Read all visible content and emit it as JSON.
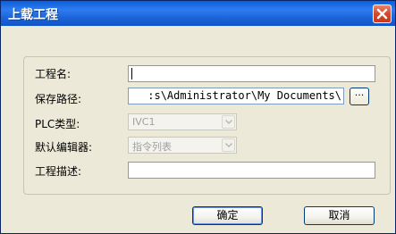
{
  "window": {
    "title": "上载工程"
  },
  "form": {
    "project_name": {
      "label": "工程名:",
      "value": ""
    },
    "save_path": {
      "label": "保存路径:",
      "value": ":s\\Administrator\\My Documents\\",
      "browse_label": "···"
    },
    "plc_type": {
      "label": "PLC类型:",
      "value": "IVC1"
    },
    "default_editor": {
      "label": "默认编辑器:",
      "value": "指令列表"
    },
    "description": {
      "label": "工程描述:",
      "value": ""
    }
  },
  "buttons": {
    "ok": "确定",
    "cancel": "取消"
  },
  "icons": {
    "close": "close-icon",
    "dropdown": "chevron-down-icon"
  },
  "colors": {
    "titlebar": "#0a5ed7",
    "close_button": "#d5482a",
    "dialog_bg": "#ece9d8"
  }
}
